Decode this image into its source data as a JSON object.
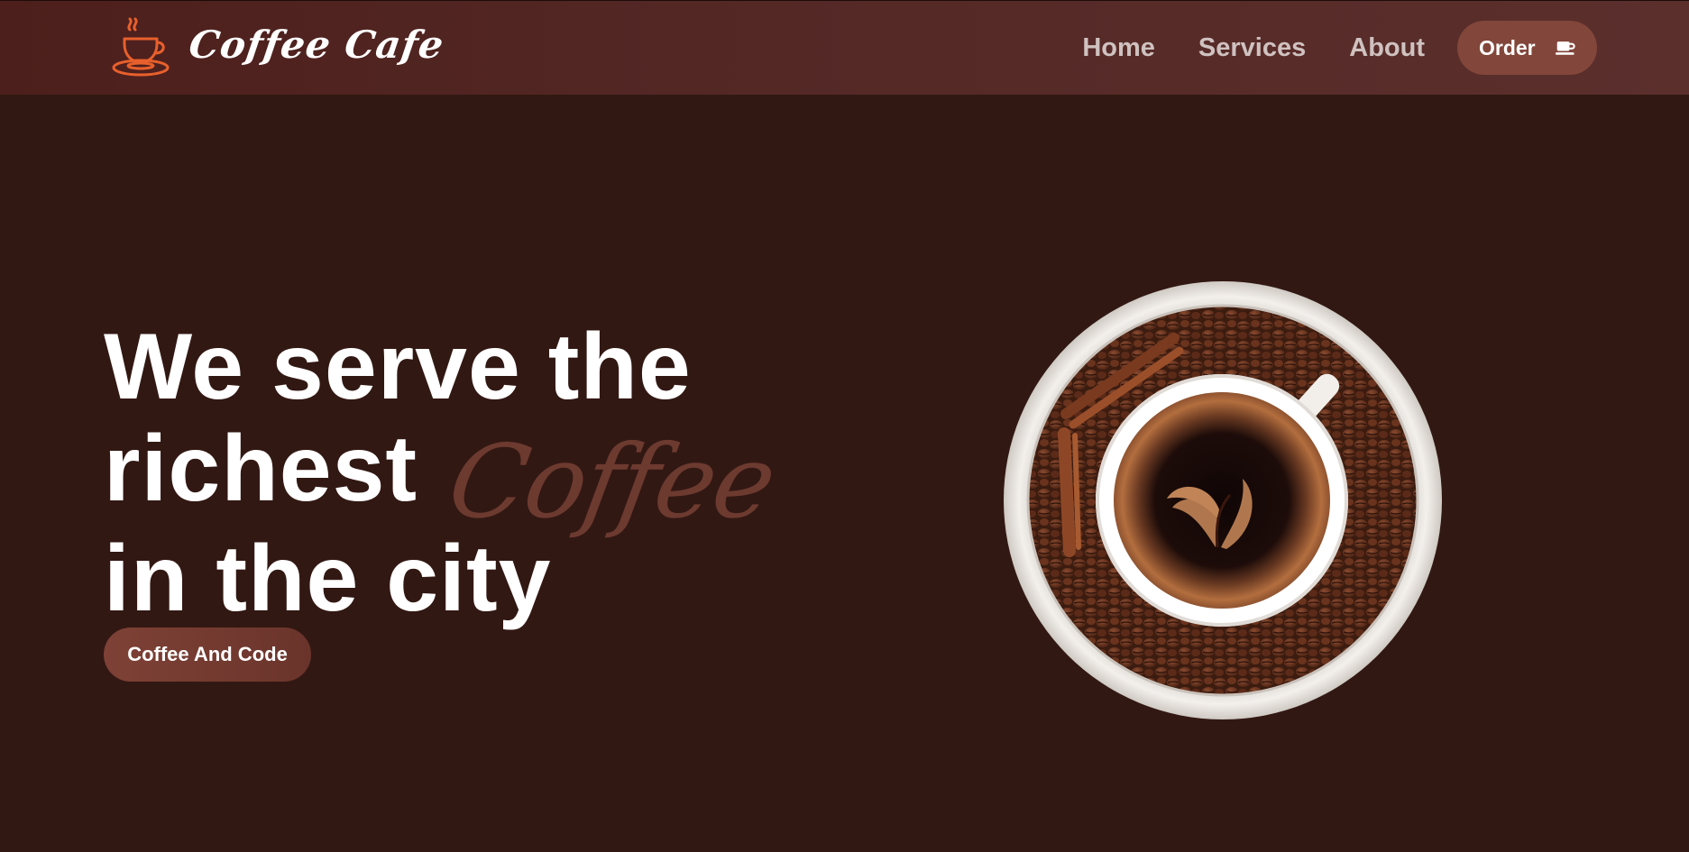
{
  "header": {
    "brand": "Coffee Cafe",
    "logo_icon": "coffee-cup-icon",
    "nav": [
      {
        "label": "Home"
      },
      {
        "label": "Services"
      },
      {
        "label": "About"
      }
    ],
    "order_button": {
      "label": "Order",
      "icon": "coffee-cup-icon"
    }
  },
  "hero": {
    "line1": "We serve the",
    "line2": "richest",
    "accent": "Coffee",
    "line3": "in the city",
    "cta_label": "Coffee And Code",
    "image": "coffee-cup-with-beans"
  },
  "colors": {
    "background": "#321813",
    "header": "#532825",
    "accent": "#6d3a30",
    "button": "#82463a",
    "logo": "#e8602c"
  }
}
